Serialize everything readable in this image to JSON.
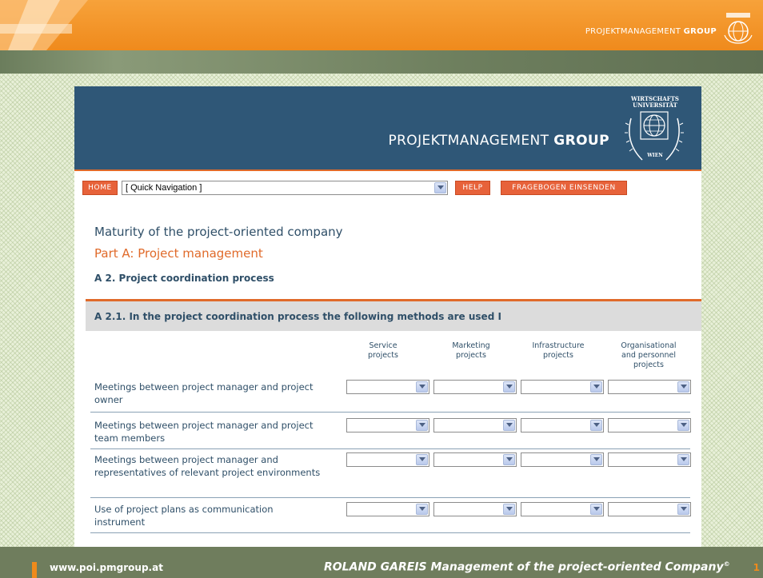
{
  "slide": {
    "brand_prefix": "PROJEKTMANAGEMENT",
    "brand_suffix": "GROUP",
    "footer_url": "www.poi.pmgroup.at",
    "footer_title": "ROLAND GAREIS Management of the project-oriented Company",
    "footer_title_mark": "©",
    "page_number": "1"
  },
  "site": {
    "seal_line1": "WIRTSCHAFTS",
    "seal_line2": "UNIVERSITÄT",
    "seal_city": "WIEN",
    "brand_prefix": "PROJEKTMANAGEMENT",
    "brand_suffix": "GROUP"
  },
  "nav": {
    "home_label": "HOME",
    "quick_nav_value": "[ Quick Navigation ]",
    "help_label": "HELP",
    "submit_label": "FRAGEBOGEN EINSENDEN"
  },
  "content": {
    "title": "Maturity of the project-oriented company",
    "part": "Part A: Project management",
    "section": "A 2. Project coordination process",
    "question": "A 2.1. In the project coordination process the following methods are used I"
  },
  "table": {
    "columns": [
      "Service\nprojects",
      "Marketing\nprojects",
      "Infrastructure\nprojects",
      "Organisational\nand personnel\nprojects"
    ],
    "rows": [
      "Meetings between project manager and project owner",
      "Meetings between project manager and project team members",
      "Meetings between project manager and representatives of relevant project environments",
      "Use of project plans as communication instrument"
    ]
  },
  "colors": {
    "accent_orange": "#e06a2a",
    "header_blue": "#2f5777",
    "text_blue": "#2f4f68",
    "slide_orange": "#ef8a1c",
    "slide_green": "#6f7d5d"
  }
}
